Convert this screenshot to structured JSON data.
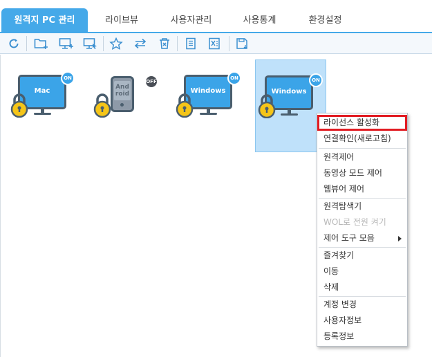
{
  "tabs": [
    {
      "label": "원격지 PC 관리",
      "active": true
    },
    {
      "label": "라이브뷰"
    },
    {
      "label": "사용자관리"
    },
    {
      "label": "사용통계"
    },
    {
      "label": "환경설정"
    }
  ],
  "toolbar": {
    "icons": [
      "refresh-icon",
      "add-folder-icon",
      "add-pc-icon",
      "remote-select-icon",
      "favorite-icon",
      "move-icon",
      "delete-icon",
      "memo-icon",
      "excel-export-icon",
      "save-icon"
    ]
  },
  "devices": [
    {
      "label": "Mac",
      "status": "ON",
      "locked": true
    },
    {
      "label_line1": "And",
      "label_line2": "roid",
      "status": "OFF",
      "locked": true
    },
    {
      "label": "Windows",
      "status": "ON",
      "locked": true
    },
    {
      "label": "Windows",
      "status": "ON",
      "locked": true,
      "selected": true
    }
  ],
  "context_menu": {
    "items": [
      {
        "label": "라이선스 활성화",
        "highlighted": true
      },
      {
        "label": "연결확인(새로고침)"
      },
      {
        "label": "원격제어"
      },
      {
        "label": "동영상 모드 제어"
      },
      {
        "label": "웹뷰어 제어"
      },
      {
        "label": "원격탐색기"
      },
      {
        "label": "WOL로 전원 켜기",
        "disabled": true
      },
      {
        "label": "제어 도구 모음",
        "has_submenu": true
      },
      {
        "label": "즐겨찾기"
      },
      {
        "label": "이동"
      },
      {
        "label": "삭제"
      },
      {
        "label": "계정 변경"
      },
      {
        "label": "사용자정보"
      },
      {
        "label": "등록정보"
      }
    ]
  },
  "colors": {
    "accent": "#45a9e9",
    "screen": "#3ba4e8",
    "lock": "#f5c518",
    "highlight_border": "#e11b22"
  }
}
